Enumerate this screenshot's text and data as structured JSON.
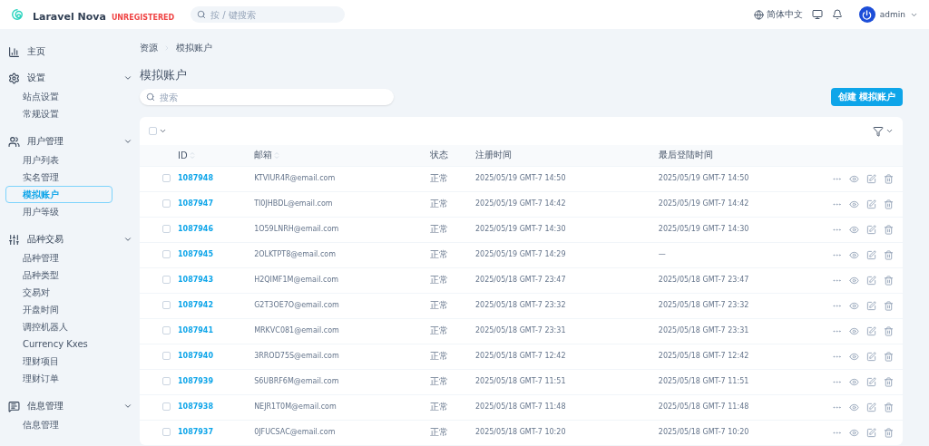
{
  "header": {
    "brand": "Laravel Nova",
    "badge": "UNREGISTERED",
    "search": {
      "placeholder": "按 / 键搜索"
    },
    "language": "简体中文",
    "user": "admin"
  },
  "sidebar": [
    {
      "kind": "link",
      "label": "主页"
    },
    {
      "kind": "group",
      "label": "设置",
      "expanded": true,
      "children": [
        {
          "label": "站点设置",
          "selected": false
        },
        {
          "label": "常规设置",
          "selected": false
        }
      ]
    },
    {
      "kind": "group",
      "label": "用户管理",
      "expanded": true,
      "children": [
        {
          "label": "用户列表",
          "selected": false
        },
        {
          "label": "实名管理",
          "selected": false
        },
        {
          "label": "模拟账户",
          "selected": true
        },
        {
          "label": "用户等级",
          "selected": false
        }
      ]
    },
    {
      "kind": "group",
      "label": "品种交易",
      "expanded": true,
      "children": [
        {
          "label": "品种管理",
          "selected": false
        },
        {
          "label": "品种类型",
          "selected": false
        },
        {
          "label": "交易对",
          "selected": false
        },
        {
          "label": "开盘时间",
          "selected": false
        },
        {
          "label": "调控机器人",
          "selected": false
        },
        {
          "label": "Currency Kxes",
          "selected": false
        },
        {
          "label": "理财项目",
          "selected": false
        },
        {
          "label": "理财订单",
          "selected": false
        }
      ]
    },
    {
      "kind": "group",
      "label": "信息管理",
      "expanded": true,
      "children": [
        {
          "label": "信息管理",
          "selected": false
        }
      ]
    }
  ],
  "breadcrumb": [
    "资源",
    "模拟账户"
  ],
  "title": "模拟账户",
  "search": {
    "placeholder": "搜索"
  },
  "create_button": "创建 模拟账户",
  "table": {
    "select_all_checked": false,
    "columns": [
      {
        "label": "ID",
        "sortable": true
      },
      {
        "label": "邮箱",
        "sortable": true
      },
      {
        "label": "状态",
        "sortable": false
      },
      {
        "label": "注册时间",
        "sortable": false
      },
      {
        "label": "最后登陆时间",
        "sortable": false
      }
    ],
    "rows": [
      {
        "checked": false,
        "cells": [
          "1087948",
          "KTVIUR4R@email.com",
          "正常",
          "2025/05/19 GMT-7 14:50",
          "2025/05/19 GMT-7 14:50"
        ]
      },
      {
        "checked": false,
        "cells": [
          "1087947",
          "TI0JHBDL@email.com",
          "正常",
          "2025/05/19 GMT-7 14:42",
          "2025/05/19 GMT-7 14:42"
        ]
      },
      {
        "checked": false,
        "cells": [
          "1087946",
          "1O59LNRH@email.com",
          "正常",
          "2025/05/19 GMT-7 14:30",
          "2025/05/19 GMT-7 14:30"
        ]
      },
      {
        "checked": false,
        "cells": [
          "1087945",
          "2OLKTPT8@email.com",
          "正常",
          "2025/05/19 GMT-7 14:29",
          "—"
        ]
      },
      {
        "checked": false,
        "cells": [
          "1087943",
          "H2QIMF1M@email.com",
          "正常",
          "2025/05/18 GMT-7 23:47",
          "2025/05/18 GMT-7 23:47"
        ]
      },
      {
        "checked": false,
        "cells": [
          "1087942",
          "G2T3OE7O@email.com",
          "正常",
          "2025/05/18 GMT-7 23:32",
          "2025/05/18 GMT-7 23:32"
        ]
      },
      {
        "checked": false,
        "cells": [
          "1087941",
          "MRKVC081@email.com",
          "正常",
          "2025/05/18 GMT-7 23:31",
          "2025/05/18 GMT-7 23:31"
        ]
      },
      {
        "checked": false,
        "cells": [
          "1087940",
          "3RROD75S@email.com",
          "正常",
          "2025/05/18 GMT-7 12:42",
          "2025/05/18 GMT-7 12:42"
        ]
      },
      {
        "checked": false,
        "cells": [
          "1087939",
          "S6UBRF6M@email.com",
          "正常",
          "2025/05/18 GMT-7 11:51",
          "2025/05/18 GMT-7 11:51"
        ]
      },
      {
        "checked": false,
        "cells": [
          "1087938",
          "NEJR1T0M@email.com",
          "正常",
          "2025/05/18 GMT-7 11:48",
          "2025/05/18 GMT-7 11:48"
        ]
      },
      {
        "checked": false,
        "cells": [
          "1087937",
          "0JFUCSAC@email.com",
          "正常",
          "2025/05/18 GMT-7 10:20",
          "2025/05/18 GMT-7 10:20"
        ]
      }
    ]
  }
}
